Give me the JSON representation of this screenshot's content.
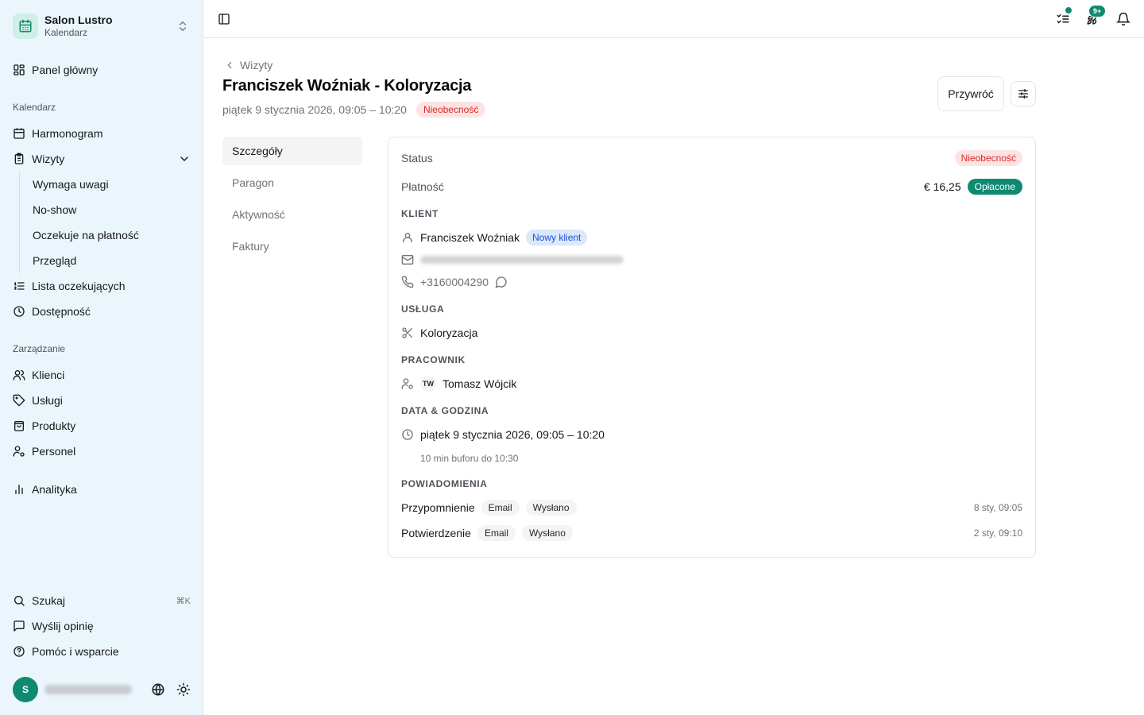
{
  "sidebar": {
    "brand": {
      "name": "Salon Lustro",
      "sub": "Kalendarz"
    },
    "dashboard": "Panel główny",
    "section_calendar": "Kalendarz",
    "schedule": "Harmonogram",
    "appointments": "Wizyty",
    "appointment_subs": [
      "Wymaga uwagi",
      "No-show",
      "Oczekuje na płatność",
      "Przegląd"
    ],
    "waitlist": "Lista oczekujących",
    "availability": "Dostępność",
    "section_management": "Zarządzanie",
    "clients": "Klienci",
    "services": "Usługi",
    "products": "Produkty",
    "staff": "Personel",
    "analytics": "Analityka",
    "search": "Szukaj",
    "search_shortcut": "⌘K",
    "feedback": "Wyślij opinię",
    "help": "Pomóc i wsparcie",
    "user_initial": "S"
  },
  "topbar": {
    "updates_count": "9+"
  },
  "header": {
    "breadcrumb": "Wizyty",
    "title": "Franciszek Woźniak - Koloryzacja",
    "datetime": "piątek 9 stycznia 2026, 09:05 – 10:20",
    "status": "Nieobecność",
    "restore_button": "Przywróć"
  },
  "subnav": [
    "Szczegóły",
    "Paragon",
    "Aktywność",
    "Faktury"
  ],
  "details": {
    "status_label": "Status",
    "status_value": "Nieobecność",
    "payment_label": "Płatność",
    "payment_amount": "€ 16,25",
    "payment_status": "Opłacone",
    "client_section": "KLIENT",
    "client_name": "Franciszek Woźniak",
    "client_badge": "Nowy klient",
    "client_phone": "+3160004290",
    "service_section": "USŁUGA",
    "service_name": "Koloryzacja",
    "staff_section": "PRACOWNIK",
    "staff_initials": "TW",
    "staff_name": "Tomasz Wójcik",
    "datetime_section": "DATA & GODZINA",
    "datetime_value": "piątek 9 stycznia 2026, 09:05 – 10:20",
    "buffer_note": "10 min buforu do 10:30",
    "notifications_section": "POWIADOMIENIA",
    "notifications": [
      {
        "name": "Przypomnienie",
        "channel": "Email",
        "state": "Wysłano",
        "time": "8 sty, 09:05"
      },
      {
        "name": "Potwierdzenie",
        "channel": "Email",
        "state": "Wysłano",
        "time": "2 sty, 09:10"
      }
    ]
  },
  "colors": {
    "accent": "#0f8a70",
    "danger": "#dc2626",
    "sidebar_bg": "#eaf6fb"
  }
}
